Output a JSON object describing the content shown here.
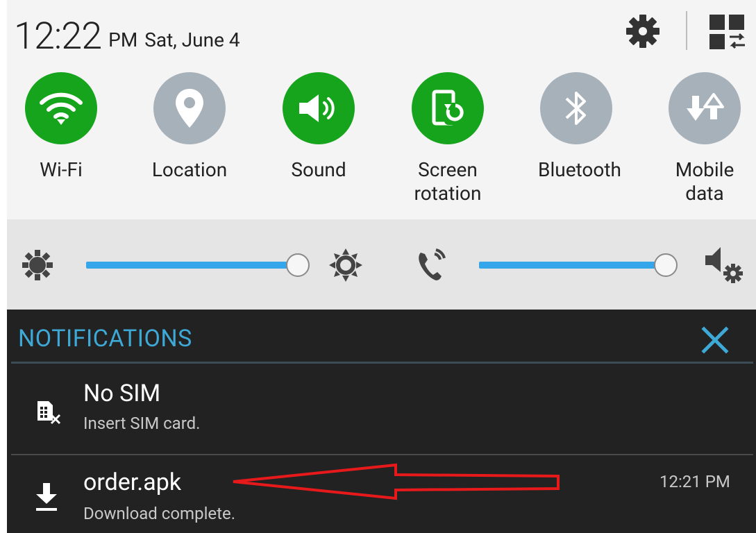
{
  "status": {
    "time": "12:22",
    "ampm": "PM",
    "date": "Sat, June 4"
  },
  "quick_settings": [
    {
      "label": "Wi-Fi",
      "icon": "wifi-icon",
      "state": "on"
    },
    {
      "label": "Location",
      "icon": "location-pin-icon",
      "state": "off"
    },
    {
      "label": "Sound",
      "icon": "speaker-icon",
      "state": "on"
    },
    {
      "label_line1": "Screen",
      "label_line2": "rotation",
      "icon": "screen-rotation-icon",
      "state": "on"
    },
    {
      "label": "Bluetooth",
      "icon": "bluetooth-icon",
      "state": "off"
    },
    {
      "label_line1": "Mobile",
      "label_line2": "data",
      "icon": "mobile-data-icon",
      "state": "off"
    }
  ],
  "sliders": {
    "brightness_level": 1.0,
    "volume_level": 1.0
  },
  "notifications": {
    "header": "NOTIFICATIONS",
    "items": [
      {
        "title": "No SIM",
        "subtitle": "Insert SIM card.",
        "icon": "no-sim-icon",
        "time": ""
      },
      {
        "title": "order.apk",
        "subtitle": "Download complete.",
        "icon": "download-icon",
        "time": "12:21 PM"
      }
    ]
  },
  "colors": {
    "active_green": "#15a41b",
    "inactive_grey": "#a7b1ba",
    "slider_blue": "#35a6e9",
    "notification_accent": "#3ea9d6",
    "annotation_arrow": "#e8191b"
  }
}
